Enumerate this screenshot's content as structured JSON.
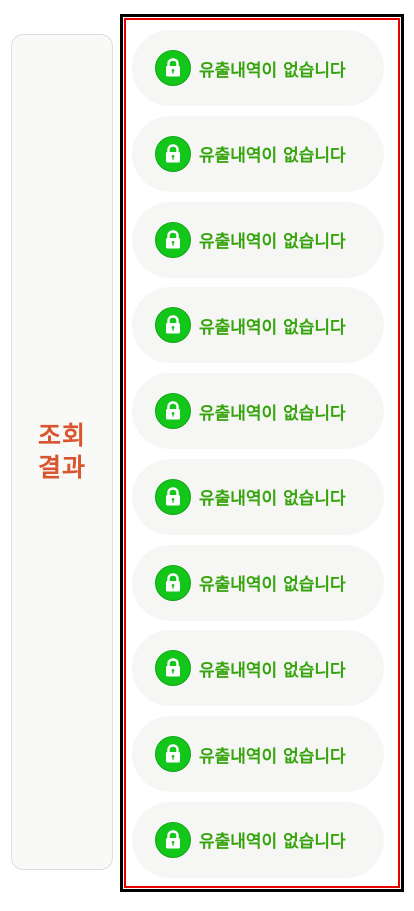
{
  "side_panel": {
    "label": "조회\n결과"
  },
  "results": {
    "items": [
      {
        "text": "유출내역이 없습니다",
        "icon": "lock-icon"
      },
      {
        "text": "유출내역이 없습니다",
        "icon": "lock-icon"
      },
      {
        "text": "유출내역이 없습니다",
        "icon": "lock-icon"
      },
      {
        "text": "유출내역이 없습니다",
        "icon": "lock-icon"
      },
      {
        "text": "유출내역이 없습니다",
        "icon": "lock-icon"
      },
      {
        "text": "유출내역이 없습니다",
        "icon": "lock-icon"
      },
      {
        "text": "유출내역이 없습니다",
        "icon": "lock-icon"
      },
      {
        "text": "유출내역이 없습니다",
        "icon": "lock-icon"
      },
      {
        "text": "유출내역이 없습니다",
        "icon": "lock-icon"
      },
      {
        "text": "유출내역이 없습니다",
        "icon": "lock-icon"
      }
    ]
  },
  "colors": {
    "label_red": "#d8552f",
    "status_green": "#36a40c",
    "badge_green": "#13c61a",
    "frame_outer": "#000000",
    "frame_inner": "#e60000"
  }
}
